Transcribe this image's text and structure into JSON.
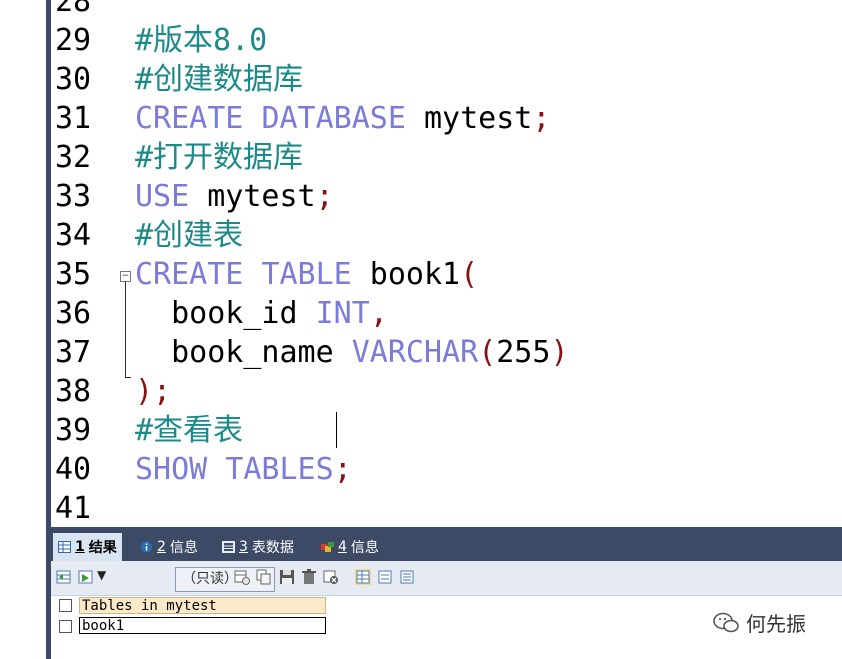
{
  "editor": {
    "lines": [
      {
        "n": "28",
        "tokens": []
      },
      {
        "n": "29",
        "tokens": [
          {
            "t": "#版本8.0",
            "c": "cm"
          }
        ]
      },
      {
        "n": "30",
        "tokens": [
          {
            "t": "#创建数据库",
            "c": "cm"
          }
        ]
      },
      {
        "n": "31",
        "tokens": [
          {
            "t": "CREATE",
            "c": "kw"
          },
          {
            "t": " "
          },
          {
            "t": "DATABASE",
            "c": "kw"
          },
          {
            "t": " mytest"
          },
          {
            "t": ";",
            "c": "pn"
          }
        ]
      },
      {
        "n": "32",
        "tokens": [
          {
            "t": "#打开数据库",
            "c": "cm"
          }
        ]
      },
      {
        "n": "33",
        "tokens": [
          {
            "t": "USE",
            "c": "kw"
          },
          {
            "t": " mytest"
          },
          {
            "t": ";",
            "c": "pn"
          }
        ]
      },
      {
        "n": "34",
        "tokens": [
          {
            "t": "#创建表",
            "c": "cm"
          }
        ]
      },
      {
        "n": "35",
        "tokens": [
          {
            "t": "CREATE",
            "c": "kw"
          },
          {
            "t": " "
          },
          {
            "t": "TABLE",
            "c": "kw"
          },
          {
            "t": " book1"
          },
          {
            "t": "(",
            "c": "pn"
          }
        ]
      },
      {
        "n": "36",
        "tokens": [
          {
            "t": "  book_id "
          },
          {
            "t": "INT",
            "c": "kw"
          },
          {
            "t": ",",
            "c": "pn"
          }
        ]
      },
      {
        "n": "37",
        "tokens": [
          {
            "t": "  book_name "
          },
          {
            "t": "VARCHAR",
            "c": "kw"
          },
          {
            "t": "(",
            "c": "pn"
          },
          {
            "t": "255"
          },
          {
            "t": ")",
            "c": "pn"
          }
        ]
      },
      {
        "n": "38",
        "tokens": [
          {
            "t": ");",
            "c": "pn"
          }
        ]
      },
      {
        "n": "39",
        "tokens": [
          {
            "t": "#查看表",
            "c": "cm"
          }
        ]
      },
      {
        "n": "40",
        "tokens": [
          {
            "t": "SHOW",
            "c": "kw"
          },
          {
            "t": " "
          },
          {
            "t": "TABLES",
            "c": "kw"
          },
          {
            "t": ";",
            "c": "pn"
          }
        ]
      },
      {
        "n": "41",
        "tokens": []
      }
    ],
    "fold_symbol": "−"
  },
  "result_tabs": [
    {
      "num": "1",
      "label": "结果",
      "icon": "grid-result-icon",
      "active": true
    },
    {
      "num": "2",
      "label": "信息",
      "icon": "info-circle-icon",
      "active": false
    },
    {
      "num": "3",
      "label": "表数据",
      "icon": "table-data-icon",
      "active": false
    },
    {
      "num": "4",
      "label": "信息",
      "icon": "colored-squares-icon",
      "active": false
    }
  ],
  "toolbar": {
    "mode_select": "（只读）",
    "mode_caret": "⌵",
    "dropdown_caret": "▼"
  },
  "results": {
    "column_header": "Tables in mytest",
    "rows": [
      "book1"
    ]
  },
  "watermark": {
    "text": "何先振",
    "icon": "wechat-icon"
  },
  "colors": {
    "keyword": "#7b7bd9",
    "comment": "#1d8a8a",
    "punctuation": "#8a1010",
    "panel": "#3c4a66"
  }
}
